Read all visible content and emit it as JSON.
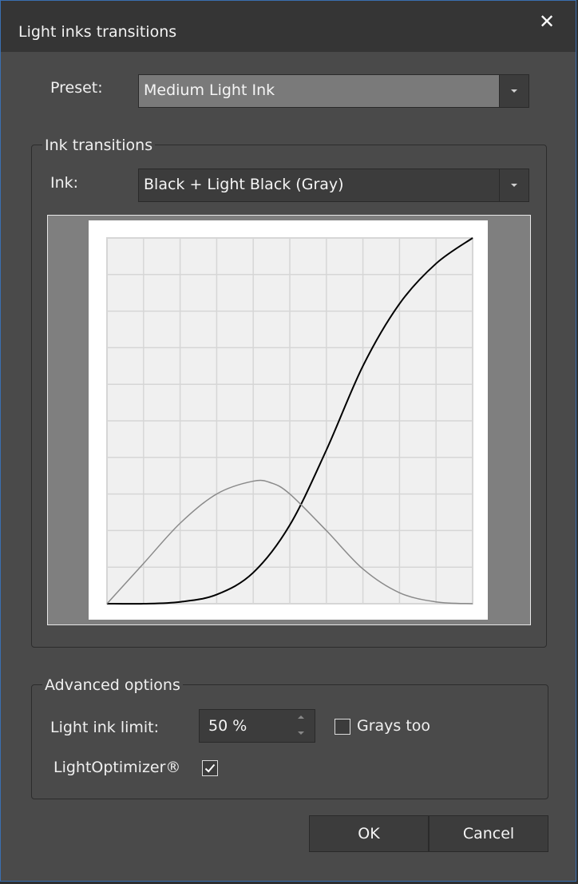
{
  "window": {
    "title": "Light inks transitions",
    "close_glyph": "✕"
  },
  "preset": {
    "label": "Preset:",
    "value": "Medium Light Ink"
  },
  "ink_transitions": {
    "legend": "Ink transitions",
    "ink_label": "Ink:",
    "ink_value": "Black + Light Black (Gray)"
  },
  "chart_data": {
    "type": "line",
    "xlim": [
      0,
      100
    ],
    "ylim": [
      0,
      100
    ],
    "grid": true,
    "grid_divisions": 10,
    "series": [
      {
        "color": "#000000",
        "x": [
          0,
          10,
          20,
          30,
          40,
          50,
          60,
          70,
          80,
          90,
          100
        ],
        "y": [
          0,
          0,
          0.5,
          2.5,
          8.5,
          21.5,
          42,
          65,
          82,
          93,
          100
        ]
      },
      {
        "color": "#8a8a8a",
        "x": [
          0,
          10,
          20,
          30,
          40,
          45,
          50,
          60,
          70,
          80,
          90,
          100
        ],
        "y": [
          0,
          11,
          22,
          30,
          33.5,
          33,
          30,
          20,
          9.5,
          3,
          0.5,
          0
        ]
      }
    ]
  },
  "advanced": {
    "legend": "Advanced options",
    "light_ink_limit_label": "Light ink limit:",
    "light_ink_limit_value": "50 %",
    "grays_too_label": "Grays too",
    "grays_too_checked": false,
    "light_optimizer_label": "LightOptimizer®",
    "light_optimizer_checked": true
  },
  "buttons": {
    "ok": "OK",
    "cancel": "Cancel"
  }
}
